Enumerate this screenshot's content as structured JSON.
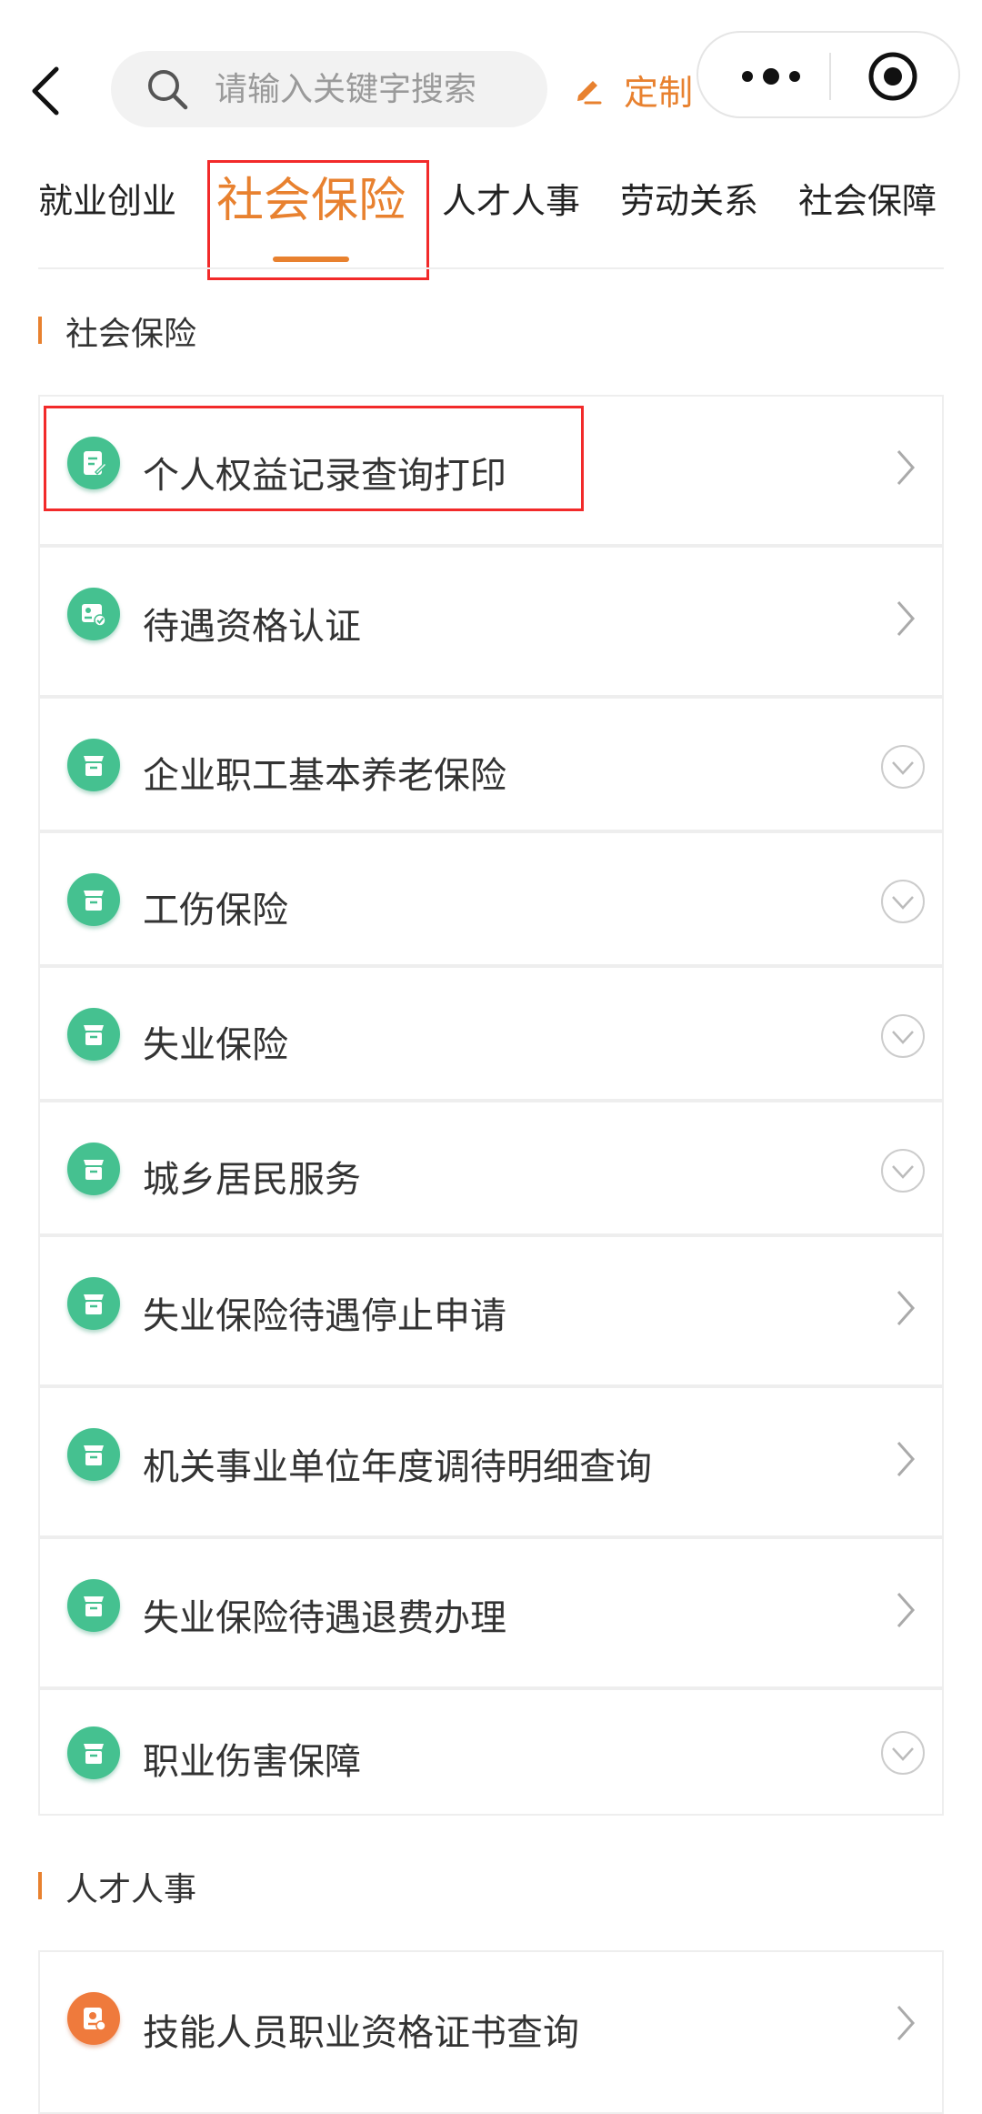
{
  "search": {
    "placeholder": "请输入关键字搜索"
  },
  "header": {
    "custom_label": "定制"
  },
  "tabs": [
    {
      "label": "就业创业"
    },
    {
      "label": "社会保险"
    },
    {
      "label": "人才人事"
    },
    {
      "label": "劳动关系"
    },
    {
      "label": "社会保障"
    }
  ],
  "active_tab": "社会保险",
  "sections": [
    {
      "title": "社会保险",
      "items": [
        {
          "label": "个人权益记录查询打印",
          "icon": "document-edit-icon",
          "action": "chevron-right"
        },
        {
          "label": "待遇资格认证",
          "icon": "id-card-check-icon",
          "action": "chevron-right"
        },
        {
          "label": "企业职工基本养老保险",
          "icon": "box-icon",
          "action": "expand-circle"
        },
        {
          "label": "工伤保险",
          "icon": "box-icon",
          "action": "expand-circle"
        },
        {
          "label": "失业保险",
          "icon": "box-icon",
          "action": "expand-circle"
        },
        {
          "label": "城乡居民服务",
          "icon": "box-icon",
          "action": "expand-circle"
        },
        {
          "label": "失业保险待遇停止申请",
          "icon": "box-icon",
          "action": "chevron-right"
        },
        {
          "label": "机关事业单位年度调待明细查询",
          "icon": "box-icon",
          "action": "chevron-right"
        },
        {
          "label": "失业保险待遇退费办理",
          "icon": "box-icon",
          "action": "chevron-right"
        },
        {
          "label": "职业伤害保障",
          "icon": "box-icon",
          "action": "expand-circle"
        }
      ]
    },
    {
      "title": "人才人事",
      "items": [
        {
          "label": "技能人员职业资格证书查询",
          "icon": "certificate-icon",
          "action": "chevron-right"
        }
      ]
    }
  ],
  "colors": {
    "accent": "#e8812f",
    "icon_green": "#45c190",
    "icon_orange": "#ef7a3c",
    "highlight_red": "#f22a2a"
  }
}
